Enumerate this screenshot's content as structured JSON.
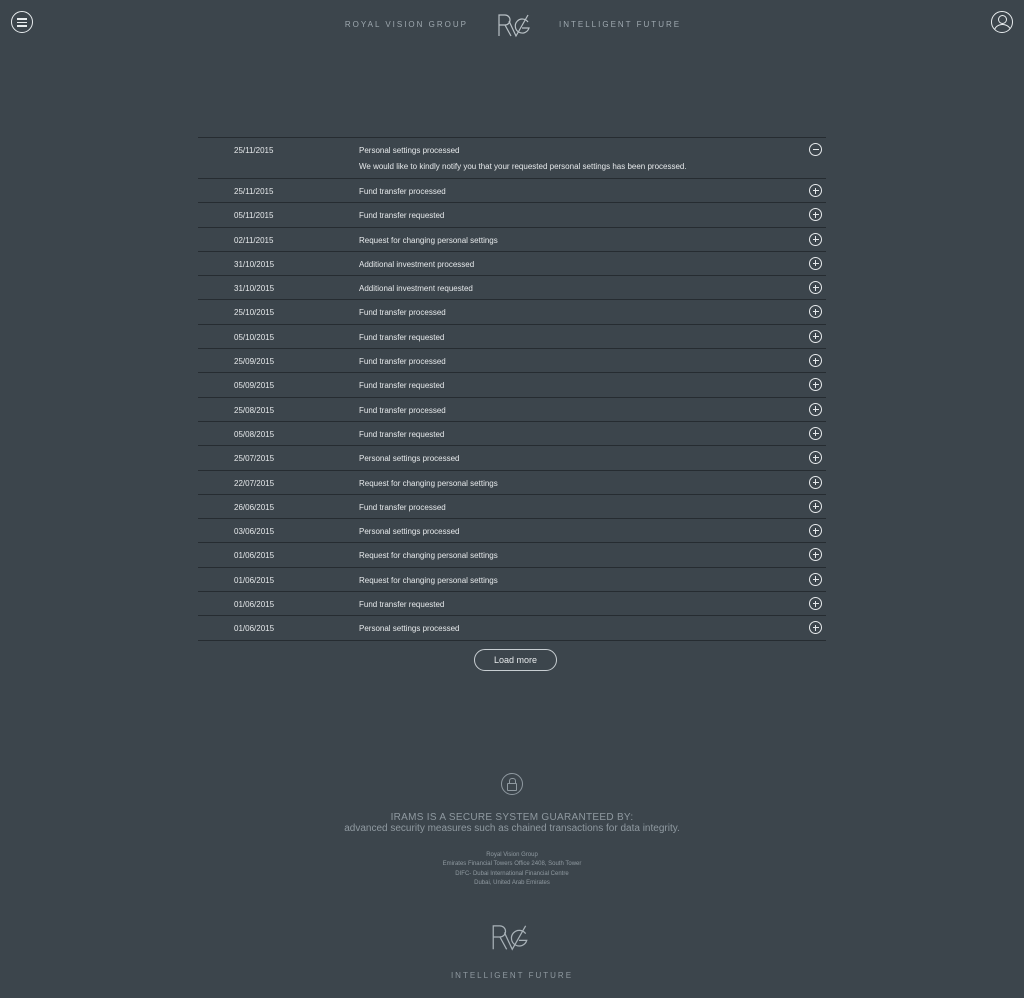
{
  "header": {
    "left_text": "ROYAL VISION GROUP",
    "right_text": "INTELLIGENT FUTURE",
    "logo_text": "RVG"
  },
  "notifications": [
    {
      "date": "25/11/2015",
      "title": "Personal settings processed",
      "message": "We would like to kindly notify you that your requested personal settings has been processed.",
      "expanded": true
    },
    {
      "date": "25/11/2015",
      "title": "Fund transfer processed"
    },
    {
      "date": "05/11/2015",
      "title": "Fund transfer requested"
    },
    {
      "date": "02/11/2015",
      "title": "Request for changing personal settings"
    },
    {
      "date": "31/10/2015",
      "title": "Additional investment processed"
    },
    {
      "date": "31/10/2015",
      "title": "Additional investment requested"
    },
    {
      "date": "25/10/2015",
      "title": "Fund transfer processed"
    },
    {
      "date": "05/10/2015",
      "title": "Fund transfer requested"
    },
    {
      "date": "25/09/2015",
      "title": "Fund transfer processed"
    },
    {
      "date": "05/09/2015",
      "title": "Fund transfer requested"
    },
    {
      "date": "25/08/2015",
      "title": "Fund transfer processed"
    },
    {
      "date": "05/08/2015",
      "title": "Fund transfer requested"
    },
    {
      "date": "25/07/2015",
      "title": "Personal settings processed"
    },
    {
      "date": "22/07/2015",
      "title": "Request for changing personal settings"
    },
    {
      "date": "26/06/2015",
      "title": "Fund transfer processed"
    },
    {
      "date": "03/06/2015",
      "title": "Personal settings processed"
    },
    {
      "date": "01/06/2015",
      "title": "Request for changing personal settings"
    },
    {
      "date": "01/06/2015",
      "title": "Request for changing personal settings"
    },
    {
      "date": "01/06/2015",
      "title": "Fund transfer requested"
    },
    {
      "date": "01/06/2015",
      "title": "Personal settings processed"
    }
  ],
  "load_more_label": "Load more",
  "footer": {
    "security_title": "IRAMS IS A SECURE SYSTEM GUARANTEED BY:",
    "security_sub": "advanced security measures such as chained transactions for data integrity.",
    "address": [
      "Royal Vision Group",
      "Emirates Financial Towers Office 2408, South Tower",
      "DIFC- Dubai International Financial Centre",
      "Dubai, United Arab Emirates"
    ],
    "tagline": "INTELLIGENT FUTURE",
    "logo_text": "RVG"
  },
  "icons": {
    "menu": "menu-icon",
    "user": "user-icon",
    "expand": "plus-circle-icon",
    "collapse": "minus-circle-icon",
    "lock": "lock-icon"
  }
}
